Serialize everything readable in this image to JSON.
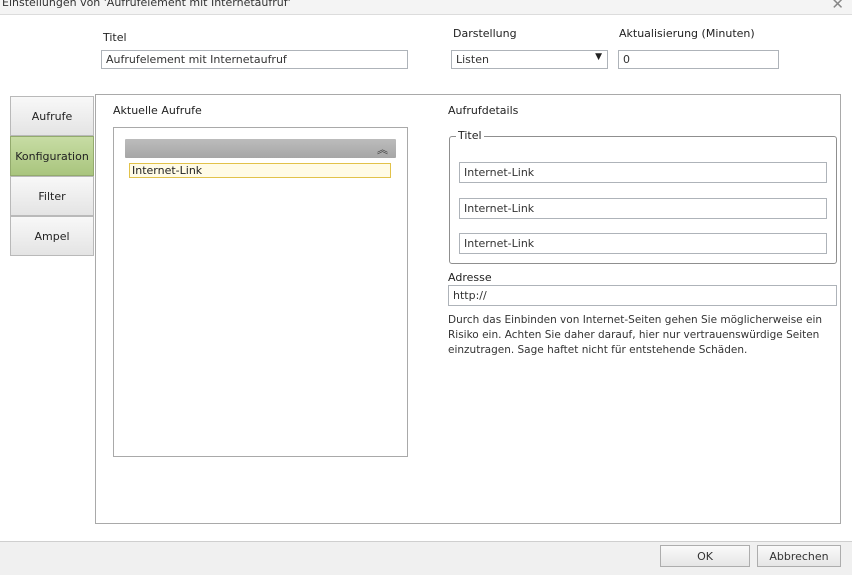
{
  "window": {
    "title": "Einstellungen von 'Aufrufelement mit Internetaufruf'",
    "close_icon": "✕"
  },
  "header": {
    "title_label": "Titel",
    "title_value": "Aufrufelement mit Internetaufruf",
    "display_label": "Darstellung",
    "display_value": "Listen",
    "refresh_label": "Aktualisierung (Minuten)",
    "refresh_value": "0"
  },
  "tabs": [
    {
      "label": "Aufrufe",
      "active": false
    },
    {
      "label": "Konfiguration",
      "active": true
    },
    {
      "label": "Filter",
      "active": false
    },
    {
      "label": "Ampel",
      "active": false
    }
  ],
  "current_calls": {
    "label": "Aktuelle Aufrufe",
    "items": [
      "Internet-Link"
    ]
  },
  "details": {
    "label": "Aufrufdetails",
    "title_group_label": "Titel",
    "title_fields": [
      "Internet-Link",
      "Internet-Link",
      "Internet-Link"
    ],
    "address_label": "Adresse",
    "address_value": "http://",
    "note": "Durch das Einbinden von Internet-Seiten gehen Sie möglicherweise ein Risiko ein. Achten Sie daher darauf, hier nur vertrauenswürdige Seiten einzutragen. Sage haftet nicht für entstehende Schäden."
  },
  "buttons": {
    "ok": "OK",
    "cancel": "Abbrechen"
  },
  "colors": {
    "active_tab": "#a9c57e",
    "selected_item_border": "#e2c24a"
  }
}
